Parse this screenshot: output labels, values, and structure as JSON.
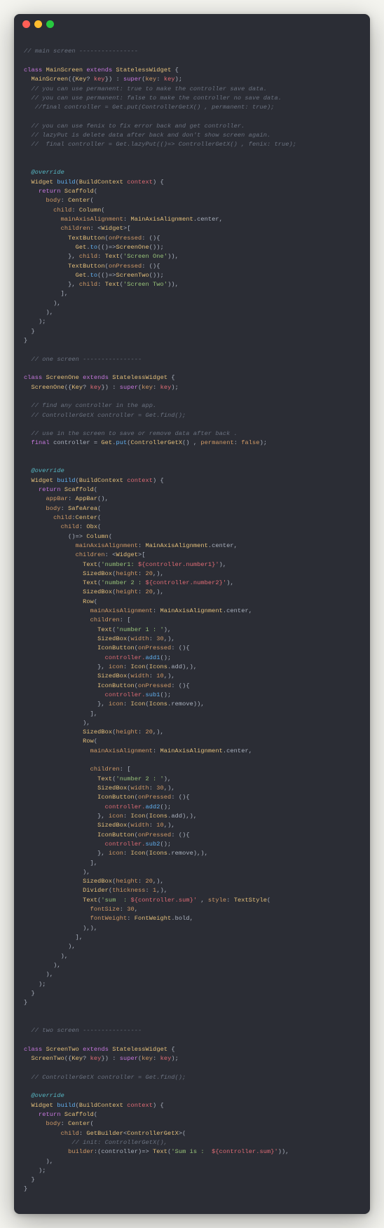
{
  "window": {
    "traffic_lights": [
      "close",
      "minimize",
      "zoom"
    ]
  },
  "code": {
    "comment_main": "// main screen ----------------",
    "class_kw": "class",
    "main_class": "MainScreen",
    "extends_kw": "extends",
    "stateless": "StatelessWidget",
    "open_brace": " {",
    "main_ctor_pre": "  ",
    "main_ctor_name": "MainScreen",
    "main_ctor_sig1": "({",
    "key_type": "Key",
    "qmark": "?",
    "key_param": " key",
    "main_ctor_sig2": "}) : ",
    "super_kw": "super",
    "super_args": "(",
    "key_attr": "key",
    "colon_sp": ": ",
    "key_val": "key",
    "main_ctor_end": ");",
    "c1": "  // you can use permanent: true to make the controller save data.",
    "c2": "  // you can use permanent: false to make the controller no save data.",
    "c3": "   //final controller = Get.put(ControllerGetX() , permanent: true);",
    "c4": "  // you can use fenix to fix error back and get controller.",
    "c5": "  // lazyPut is delete data after back and don't show screen again.",
    "c6": "  //  final controller = Get.lazyPut(()=> ControllerGetX() , fenix: true);",
    "override": "@override",
    "widget_type": "Widget",
    "build_fn": "build",
    "build_sig1": "(",
    "buildcontext": "BuildContext",
    "context_param": " context",
    "build_sig2": ") {",
    "return_kw": "return",
    "scaffold": "Scaffold",
    "body_attr": "body",
    "center_t": "Center",
    "child_attr": "child",
    "column_t": "Column",
    "maa_attr": "mainAxisAlignment",
    "maa_t": "MainAxisAlignment",
    "maa_val": ".center,",
    "children_attr": "children",
    "widget_list": ": <",
    "widget_t": "Widget",
    "list_open": ">[",
    "textbutton_t": "TextButton",
    "onpressed_attr": "onPressed",
    "arrow_open": ": (){",
    "get_t": "Get",
    "to_fn": "to",
    "to_args1": "(()=>",
    "screenone_t": "ScreenOne",
    "ctor_call": "());",
    "close_paren_child": "}, ",
    "child_attr2": "child",
    "text_t": "Text",
    "str_screen_one": "'Screen One'",
    "close_widget": ")),",
    "screentwo_t": "ScreenTwo",
    "str_screen_two": "'Screen Two'",
    "close_list": "],",
    "close_paren": "),",
    "close_semi": ");",
    "close_brace": "}",
    "comment_one": "  // one screen ----------------",
    "one_class": "ScreenOne",
    "c7": "  // find any controller in the app.",
    "c8": "  // ControllerGetX controller = Get.find();",
    "c9": "  // use in the screen to save or remove data after back .",
    "final_kw": "final",
    "controller_var": " controller = ",
    "put_fn": "put",
    "put_args": "(",
    "controllergetx_t": "ControllerGetX",
    "put_args2": "() , ",
    "permanent_attr": "permanent",
    "false_kw": "false",
    "put_end": ");",
    "appbar_attr": "appBar",
    "appbar_t": "AppBar",
    "appbar_end": "(),",
    "safearea_t": "SafeArea",
    "obx_t": "Obx",
    "obx_open": "(",
    "obx_arrow": "()=> ",
    "str_num1": "'number1: ",
    "interp_open": "${",
    "ctrl_num1": "controller.number1",
    "interp_close": "}'",
    "close_text": "),",
    "sizedbox_t": "SizedBox",
    "height_attr": "height",
    "n20": "20",
    "sb_end": ",),",
    "str_num2_lbl": "'number 2 : ",
    "ctrl_num2": "controller.number2",
    "row_t": "Row",
    "children_open": ": [",
    "str_num1_colon": "'number 1 : '",
    "width_attr": "width",
    "n30": "30",
    "iconbutton_t": "IconButton",
    "add1_fn": "add1",
    "ctrl_call": "controller.",
    "fn_end": "();",
    "icon_attr": "icon",
    "icon_t": "Icon",
    "icons_t": "Icons",
    "icon_add": ".add),),",
    "n10": "10",
    "sub1_fn": "sub1",
    "icon_remove": ".remove)),",
    "str_num2_colon": "'number 2 : '",
    "add2_fn": "add2",
    "sub2_fn": "sub2",
    "icon_remove2": ".remove),),",
    "divider_t": "Divider",
    "thickness_attr": "thickness",
    "n1": "1",
    "str_sum": "'sum  : ",
    "ctrl_sum": "controller.sum",
    "style_attr": "style",
    "textstyle_t": "TextStyle",
    "fontsize_attr": "fontSize",
    "n30b": "30",
    "fontweight_attr": "fontWeight",
    "fontweight_t": "FontWeight",
    "bold_val": ".bold,",
    "close_text2": "),),",
    "comment_two": "  // two screen ----------------",
    "two_class": "ScreenTwo",
    "c10": "  // ControllerGetX controller = Get.find();",
    "getbuilder_t": "GetBuilder",
    "gb_open": "<",
    "gb_close": ">(",
    "c11": "// init: ControllerGetX(),",
    "builder_attr": "builder",
    "builder_args": ":(controller)=> ",
    "str_sumis": "'Sum is :  ",
    "close_text3": ")),"
  }
}
